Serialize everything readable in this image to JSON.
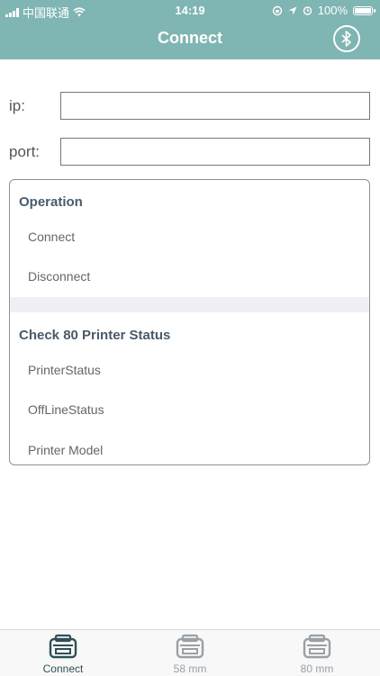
{
  "status_bar": {
    "carrier": "中国联通",
    "time": "14:19",
    "battery": "100%"
  },
  "nav": {
    "title": "Connect"
  },
  "form": {
    "ip_label": "ip:",
    "ip_value": "",
    "port_label": "port:",
    "port_value": ""
  },
  "panel": {
    "operation_header": "Operation",
    "connect": "Connect",
    "disconnect": "Disconnect",
    "status_header": "Check 80 Printer Status",
    "printer_status": "PrinterStatus",
    "offline_status": "OffLineStatus",
    "printer_model": "Printer Model"
  },
  "tabs": [
    {
      "label": "Connect",
      "active": true
    },
    {
      "label": "58 mm",
      "active": false
    },
    {
      "label": "80 mm",
      "active": false
    }
  ],
  "colors": {
    "accent": "#7fb5b3",
    "active_tab": "#2f4f56",
    "inactive_tab": "#9aa0a6"
  }
}
